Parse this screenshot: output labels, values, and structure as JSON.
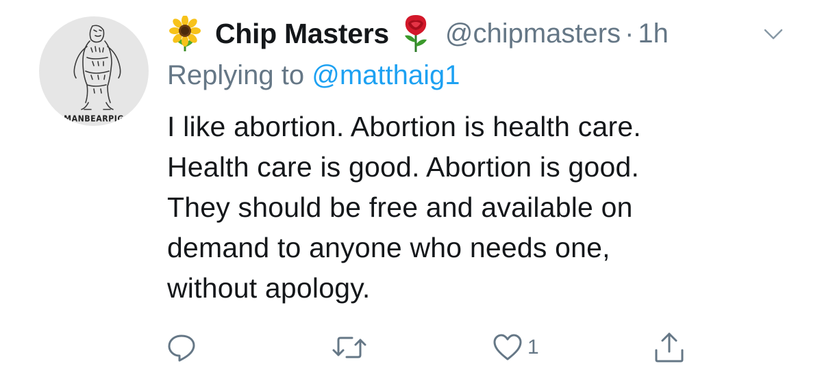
{
  "author": {
    "name": "Chip Masters",
    "handle": "@chipmasters",
    "separator": "·",
    "time": "1h",
    "avatar_caption": "MANBEARPIG",
    "name_prefix_emoji": "sunflower-icon",
    "name_suffix_emoji": "rose-icon"
  },
  "reply": {
    "prefix": "Replying to",
    "target": "@matthaig1"
  },
  "tweet": {
    "lines": [
      "I like abortion. Abortion is health care.",
      "Health care is good. Abortion is good.",
      "They should be free and available on",
      "demand to anyone who needs one,",
      "without apology."
    ]
  },
  "actions": {
    "reply_icon": "reply-icon",
    "retweet_icon": "retweet-icon",
    "like_icon": "heart-icon",
    "like_count": "1",
    "share_icon": "share-icon"
  },
  "colors": {
    "text": "#14171a",
    "secondary": "#657786",
    "link": "#1da1f2",
    "background": "#ffffff"
  }
}
